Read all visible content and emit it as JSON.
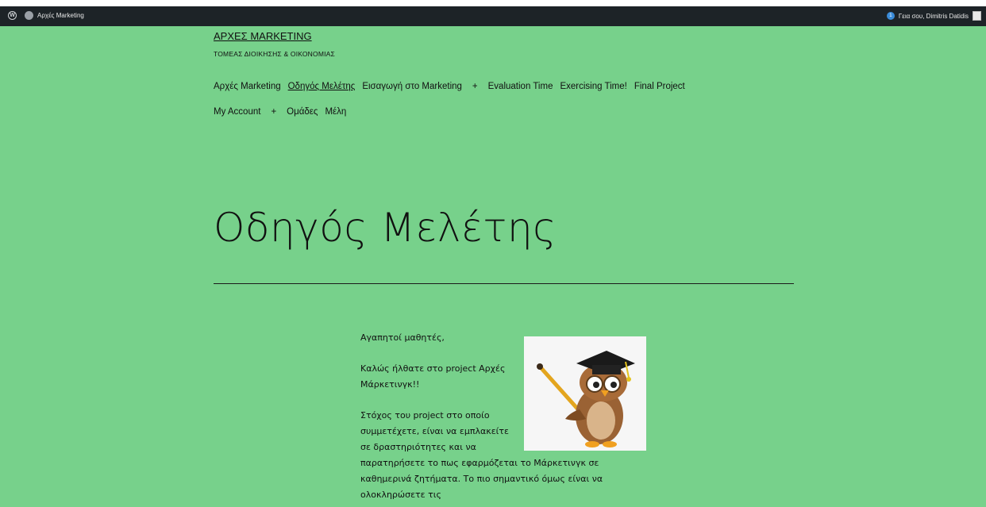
{
  "admin_bar": {
    "site_name": "Αρχές Marketing",
    "greeting": "Γεια σου, Dimitris Datidis",
    "notification_count": "1"
  },
  "header": {
    "site_title": "ΑΡΧΕΣ MARKETING",
    "site_description": "ΤΟΜΕΑΣ ΔΙΟΙΚΗΣΗΣ & ΟΙΚΟΝΟΜΙΑΣ"
  },
  "nav": {
    "row1": [
      "Αρχές Marketing",
      "Οδηγός Μελέτης",
      "Εισαγωγή στο Marketing",
      "+",
      "Evaluation Time",
      "Exercising Time!",
      "Final Project"
    ],
    "row2": [
      "My Account",
      "+",
      "Ομάδες",
      "Μέλη"
    ]
  },
  "page": {
    "title": "Οδηγός Μελέτης",
    "paragraphs": [
      "Αγαπητοί μαθητές,",
      "Καλώς ήλθατε στο project Αρχές Μάρκετινγκ!!",
      "Στόχος του project στο οποίο συμμετέχετε, είναι να εμπλακείτε σε δραστηριότητες και να",
      "παρατηρήσετε το πως εφαρμόζεται το Μάρκετινγκ σε καθημερινά ζητήματα. Το πιο σημαντικό όμως είναι να ολοκληρώσετε τις"
    ]
  },
  "colors": {
    "page_background": "#77d18b",
    "admin_bar": "#1d2327"
  }
}
